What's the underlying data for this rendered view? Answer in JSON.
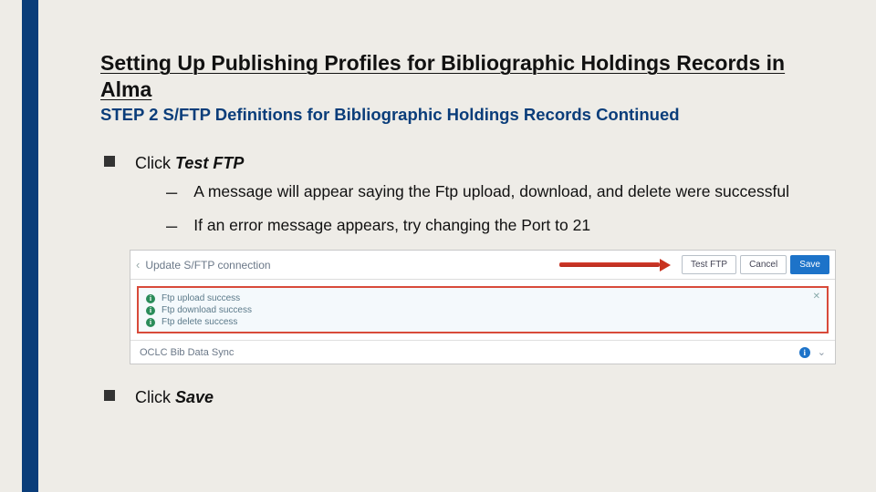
{
  "title": "Setting Up Publishing Profiles for Bibliographic Holdings Records in Alma",
  "subtitle": "STEP 2 S/FTP Definitions for Bibliographic Holdings Records Continued",
  "points": {
    "p1_pre": "Click ",
    "p1_bold": "Test FTP",
    "p1a": "A message will appear saying the Ftp upload, download, and delete were successful",
    "p1b": "If an error message appears, try changing the Port to 21",
    "p2_pre": "Click ",
    "p2_bold": "Save"
  },
  "panel": {
    "header": "Update S/FTP connection",
    "buttons": {
      "test": "Test FTP",
      "cancel": "Cancel",
      "save": "Save"
    },
    "messages": [
      "Ftp upload success",
      "Ftp download success",
      "Ftp delete success"
    ],
    "footer": "OCLC Bib Data Sync"
  }
}
